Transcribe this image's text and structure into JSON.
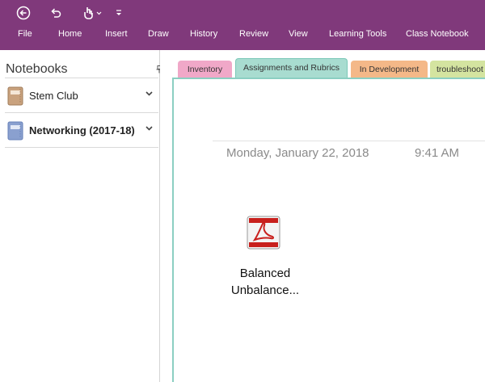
{
  "quick_access": {
    "icons": [
      "back-icon",
      "undo-icon",
      "touch-mode-icon",
      "customize-icon"
    ]
  },
  "ribbon": {
    "tabs": [
      "File",
      "Home",
      "Insert",
      "Draw",
      "History",
      "Review",
      "View",
      "Learning Tools",
      "Class Notebook"
    ]
  },
  "notebooks": {
    "header": "Notebooks",
    "items": [
      {
        "label": "Stem Club",
        "color": "#c9a27e"
      },
      {
        "label": "Networking (2017-18)",
        "color": "#8aa0cf"
      }
    ]
  },
  "sections": [
    {
      "label": "Inventory",
      "color": "#f0a8c8"
    },
    {
      "label": "Assignments and Rubrics",
      "color": "#a8dcd0"
    },
    {
      "label": "In Development",
      "color": "#f4b888"
    },
    {
      "label": "troubleshoot",
      "color": "#d4e4a0"
    }
  ],
  "page": {
    "date": "Monday, January 22, 2018",
    "time": "9:41 AM",
    "attachment": {
      "name_line1": "Balanced",
      "name_line2": "Unbalance..."
    }
  },
  "colors": {
    "ribbon": "#80397b",
    "active_section_border": "#8ccfc2"
  }
}
